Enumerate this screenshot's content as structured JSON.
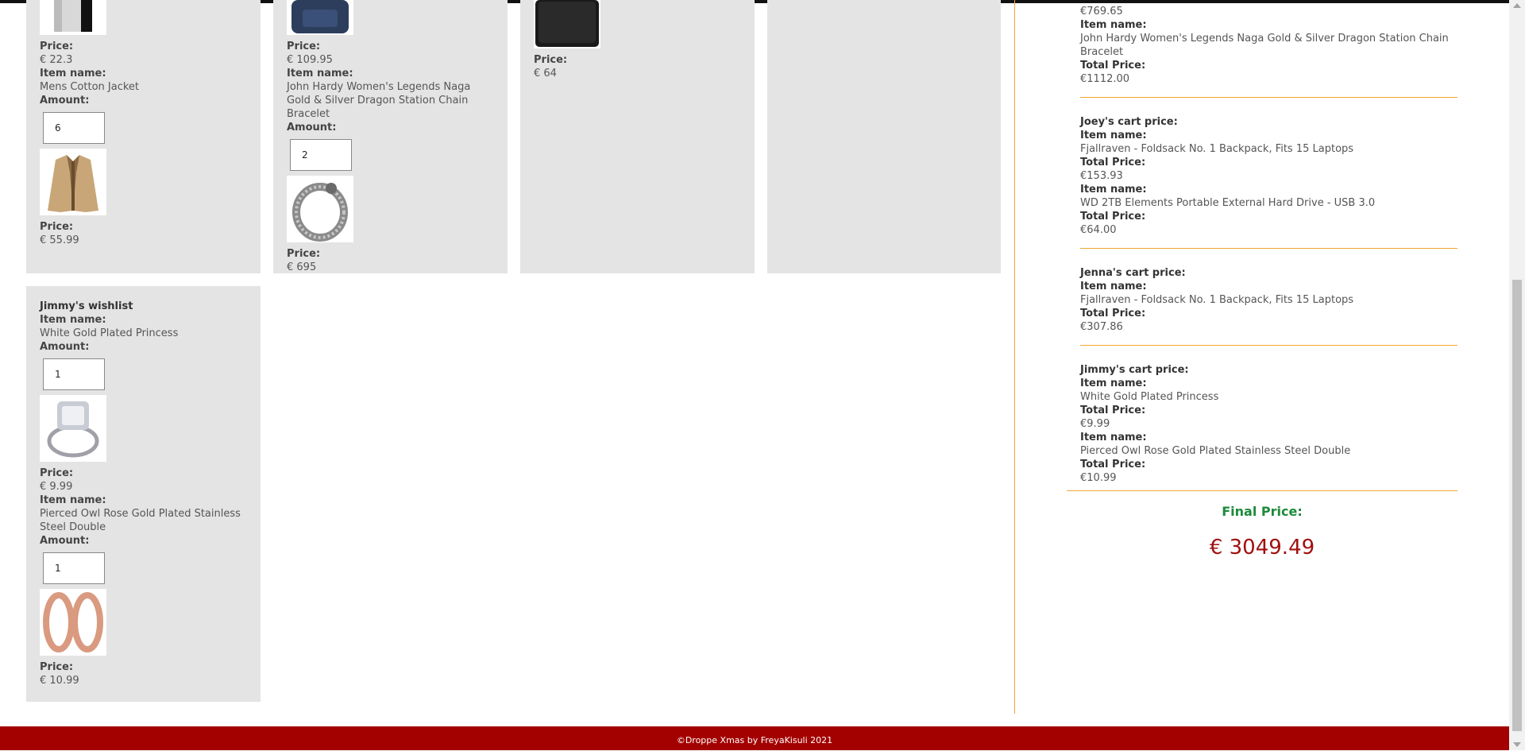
{
  "labels": {
    "price": "Price:",
    "item_name": "Item name:",
    "amount": "Amount:",
    "total_price": "Total Price:"
  },
  "wishlists": {
    "c1": {
      "price1": "€ 22.3",
      "item2": "Mens Cotton Jacket",
      "amount2": "6",
      "price2": "€ 55.99"
    },
    "c2": {
      "price1": "€ 109.95",
      "item2": "John Hardy Women's Legends Naga Gold & Silver Dragon Station Chain Bracelet",
      "amount2": "2",
      "price2": "€ 695"
    },
    "c3": {
      "price1": "€ 64"
    },
    "jimmy": {
      "title": "Jimmy's wishlist",
      "item1": "White Gold Plated Princess",
      "amount1": "1",
      "price1": "€ 9.99",
      "item2": "Pierced Owl Rose Gold Plated Stainless Steel Double",
      "amount2": "1",
      "price2": "€ 10.99"
    }
  },
  "carts": {
    "top": {
      "total1": "€769.65",
      "item2": "John Hardy Women's Legends Naga Gold & Silver Dragon Station Chain Bracelet",
      "total2": "€1112.00"
    },
    "joey": {
      "title": "Joey's cart price:",
      "item1": "Fjallraven - Foldsack No. 1 Backpack, Fits 15 Laptops",
      "total1": "€153.93",
      "item2": "WD 2TB Elements Portable External Hard Drive - USB 3.0",
      "total2": "€64.00"
    },
    "jenna": {
      "title": "Jenna's cart price:",
      "item1": "Fjallraven - Foldsack No. 1 Backpack, Fits 15 Laptops",
      "total1": "€307.86"
    },
    "jimmy": {
      "title": "Jimmy's cart price:",
      "item1": "White Gold Plated Princess",
      "total1": "€9.99",
      "item2": "Pierced Owl Rose Gold Plated Stainless Steel Double",
      "total2": "€10.99"
    }
  },
  "final": {
    "label": "Final Price:",
    "value": "€ 3049.49"
  },
  "footer": {
    "text": "©Droppe Xmas by FreyaKisuli 2021"
  },
  "colors": {
    "accent_orange": "#f0a830",
    "footer_red": "#a30000",
    "final_label_green": "#1d8a3a",
    "final_value_red": "#a01010",
    "card_bg": "#e4e4e4"
  }
}
